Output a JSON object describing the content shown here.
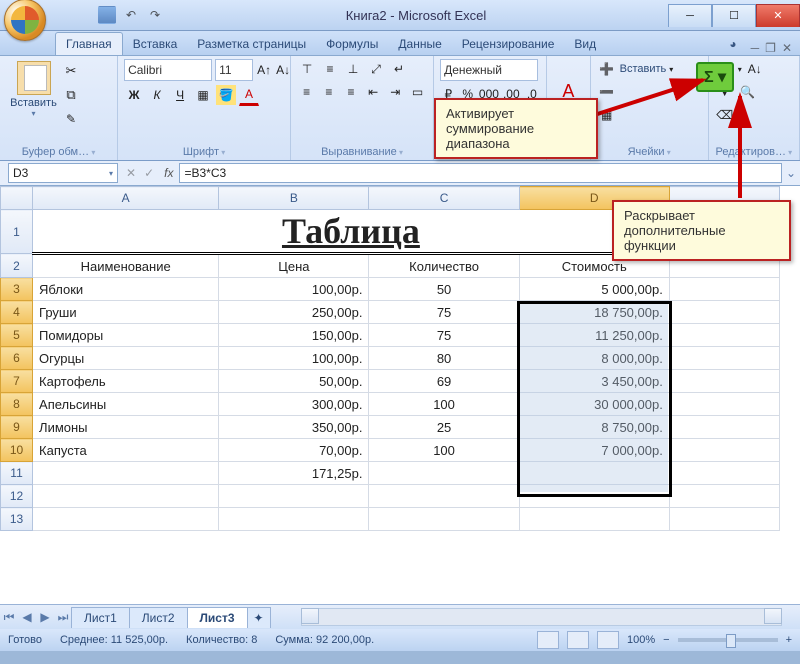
{
  "window": {
    "title": "Книга2 - Microsoft Excel"
  },
  "qat": {
    "save": "save",
    "undo": "undo",
    "redo": "redo"
  },
  "tabs": {
    "list": [
      {
        "label": "Главная",
        "active": true
      },
      {
        "label": "Вставка"
      },
      {
        "label": "Разметка страницы"
      },
      {
        "label": "Формулы"
      },
      {
        "label": "Данные"
      },
      {
        "label": "Рецензирование"
      },
      {
        "label": "Вид"
      }
    ]
  },
  "ribbon": {
    "clipboard": {
      "label": "Буфер обм…",
      "paste": "Вставить"
    },
    "font": {
      "label": "Шрифт",
      "family": "Calibri",
      "size": "11"
    },
    "align": {
      "label": "Выравнивание"
    },
    "number": {
      "label": "…",
      "format": "Денежный"
    },
    "cells": {
      "label": "Ячейки",
      "insert": "Вставить"
    },
    "edit": {
      "label": "Редактиров…"
    }
  },
  "formula": {
    "namebox": "D3",
    "fx": "fx",
    "value": "=B3*C3"
  },
  "columns": [
    "",
    "A",
    "B",
    "C",
    "D"
  ],
  "title_cell": "Таблица",
  "headers": {
    "name": "Наименование",
    "price": "Цена",
    "qty": "Количество",
    "cost": "Стоимость"
  },
  "rows": [
    {
      "name": "Яблоки",
      "price": "100,00р.",
      "qty": "50",
      "cost": "5 000,00р."
    },
    {
      "name": "Груши",
      "price": "250,00р.",
      "qty": "75",
      "cost": "18 750,00р."
    },
    {
      "name": "Помидоры",
      "price": "150,00р.",
      "qty": "75",
      "cost": "11 250,00р."
    },
    {
      "name": "Огурцы",
      "price": "100,00р.",
      "qty": "80",
      "cost": "8 000,00р."
    },
    {
      "name": "Картофель",
      "price": "50,00р.",
      "qty": "69",
      "cost": "3 450,00р."
    },
    {
      "name": "Апельсины",
      "price": "300,00р.",
      "qty": "100",
      "cost": "30 000,00р."
    },
    {
      "name": "Лимоны",
      "price": "350,00р.",
      "qty": "25",
      "cost": "8 750,00р."
    },
    {
      "name": "Капуста",
      "price": "70,00р.",
      "qty": "100",
      "cost": "7 000,00р."
    }
  ],
  "avg_row": {
    "price": "171,25р."
  },
  "sheets": {
    "list": [
      "Лист1",
      "Лист2",
      "Лист3"
    ],
    "active": 2
  },
  "status": {
    "ready": "Готово",
    "avg": "Среднее: 11 525,00р.",
    "count": "Количество: 8",
    "sum": "Сумма: 92 200,00р.",
    "zoom": "100%"
  },
  "callouts": {
    "c1": "Активирует суммирование диапазона",
    "c2": "Раскрывает дополнительные функции"
  },
  "autosum": {
    "sigma": "Σ ▾"
  }
}
